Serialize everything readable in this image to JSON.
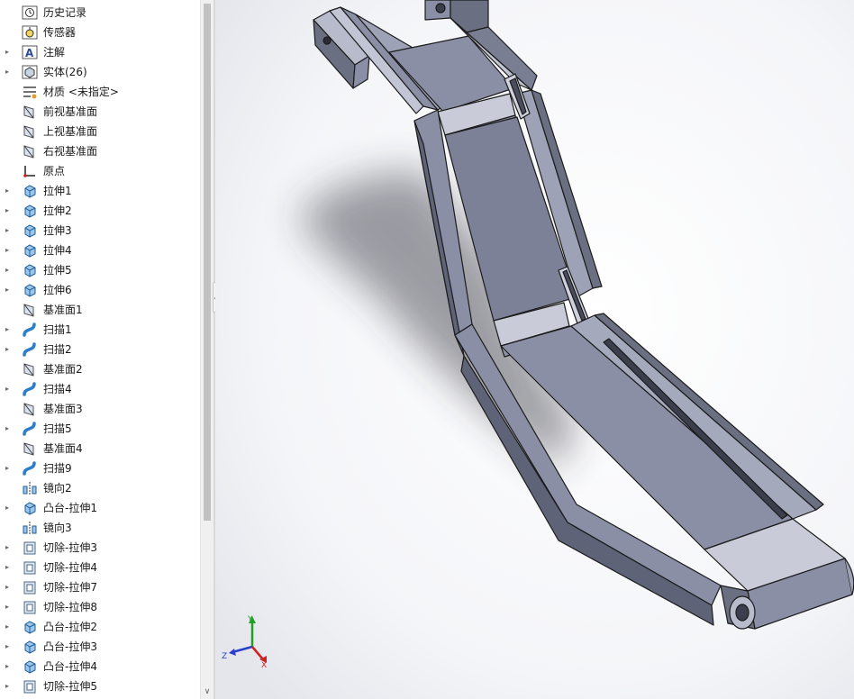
{
  "feature_tree": {
    "items": [
      {
        "label": "历史记录",
        "icon": "history-icon",
        "expandable": false
      },
      {
        "label": "传感器",
        "icon": "sensor-icon",
        "expandable": false
      },
      {
        "label": "注解",
        "icon": "annotation-icon",
        "expandable": true
      },
      {
        "label": "实体(26)",
        "icon": "solid-bodies-icon",
        "expandable": true
      },
      {
        "label": "材质 <未指定>",
        "icon": "material-icon",
        "expandable": false
      },
      {
        "label": "前视基准面",
        "icon": "plane-icon",
        "expandable": false
      },
      {
        "label": "上视基准面",
        "icon": "plane-icon",
        "expandable": false
      },
      {
        "label": "右视基准面",
        "icon": "plane-icon",
        "expandable": false
      },
      {
        "label": "原点",
        "icon": "origin-icon",
        "expandable": false
      },
      {
        "label": "拉伸1",
        "icon": "extrude-icon",
        "expandable": true
      },
      {
        "label": "拉伸2",
        "icon": "extrude-icon",
        "expandable": true
      },
      {
        "label": "拉伸3",
        "icon": "extrude-icon",
        "expandable": true
      },
      {
        "label": "拉伸4",
        "icon": "extrude-icon",
        "expandable": true
      },
      {
        "label": "拉伸5",
        "icon": "extrude-icon",
        "expandable": true
      },
      {
        "label": "拉伸6",
        "icon": "extrude-icon",
        "expandable": true
      },
      {
        "label": "基准面1",
        "icon": "plane-icon",
        "expandable": false
      },
      {
        "label": "扫描1",
        "icon": "sweep-icon",
        "expandable": true
      },
      {
        "label": "扫描2",
        "icon": "sweep-icon",
        "expandable": true
      },
      {
        "label": "基准面2",
        "icon": "plane-icon",
        "expandable": false
      },
      {
        "label": "扫描4",
        "icon": "sweep-icon",
        "expandable": true
      },
      {
        "label": "基准面3",
        "icon": "plane-icon",
        "expandable": false
      },
      {
        "label": "扫描5",
        "icon": "sweep-icon",
        "expandable": true
      },
      {
        "label": "基准面4",
        "icon": "plane-icon",
        "expandable": false
      },
      {
        "label": "扫描9",
        "icon": "sweep-icon",
        "expandable": true
      },
      {
        "label": "镜向2",
        "icon": "mirror-icon",
        "expandable": false
      },
      {
        "label": "凸台-拉伸1",
        "icon": "extrude-icon",
        "expandable": true
      },
      {
        "label": "镜向3",
        "icon": "mirror-icon",
        "expandable": false
      },
      {
        "label": "切除-拉伸3",
        "icon": "cut-extrude-icon",
        "expandable": true
      },
      {
        "label": "切除-拉伸4",
        "icon": "cut-extrude-icon",
        "expandable": true
      },
      {
        "label": "切除-拉伸7",
        "icon": "cut-extrude-icon",
        "expandable": true
      },
      {
        "label": "切除-拉伸8",
        "icon": "cut-extrude-icon",
        "expandable": true
      },
      {
        "label": "凸台-拉伸2",
        "icon": "extrude-icon",
        "expandable": true
      },
      {
        "label": "凸台-拉伸3",
        "icon": "extrude-icon",
        "expandable": true
      },
      {
        "label": "凸台-拉伸4",
        "icon": "extrude-icon",
        "expandable": true
      },
      {
        "label": "切除-拉伸5",
        "icon": "cut-extrude-icon",
        "expandable": true
      }
    ]
  },
  "triad": {
    "x_label": "X",
    "y_label": "Y",
    "z_label": "Z"
  },
  "colors": {
    "part_face": "#8a8fa6",
    "part_dark": "#5f6377",
    "part_light": "#b7bbcc",
    "edge": "#1b1b1b",
    "x_axis": "#cc2222",
    "y_axis": "#22a022",
    "z_axis": "#2a3fcc"
  }
}
